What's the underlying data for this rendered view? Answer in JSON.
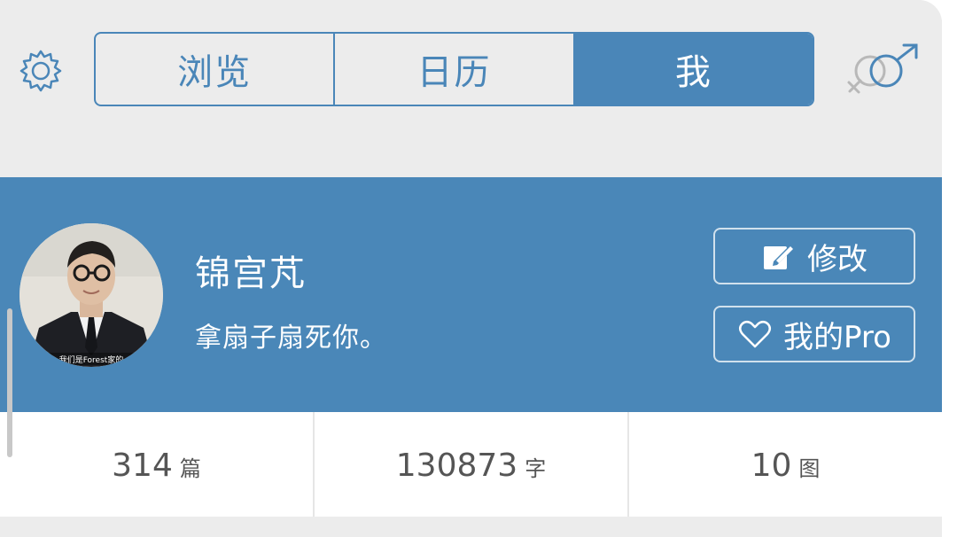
{
  "tabs": [
    {
      "label": "浏览",
      "active": false
    },
    {
      "label": "日历",
      "active": false
    },
    {
      "label": "我",
      "active": true
    }
  ],
  "icons": {
    "settings": "gear-icon",
    "gender": "gender-symbol-icon",
    "edit": "edit-icon",
    "pro": "heart-icon"
  },
  "colors": {
    "accent": "#4a86b8",
    "banner": "#4a87b8",
    "background": "#ececec"
  },
  "profile": {
    "name": "锦宫芃",
    "bio": "拿扇子扇死你。",
    "avatar_caption": "我们是Forest家的",
    "edit_label": "修改",
    "pro_label": "我的Pro"
  },
  "stats": [
    {
      "value": "314",
      "unit": "篇"
    },
    {
      "value": "130873",
      "unit": "字"
    },
    {
      "value": "10",
      "unit": "图"
    }
  ]
}
